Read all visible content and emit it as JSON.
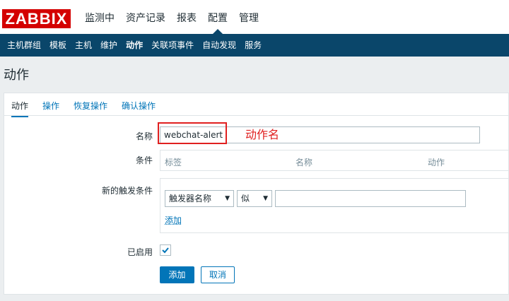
{
  "header": {
    "logo": "ZABBIX",
    "menu": [
      {
        "label": "监测中"
      },
      {
        "label": "资产记录"
      },
      {
        "label": "报表"
      },
      {
        "label": "配置"
      },
      {
        "label": "管理"
      }
    ]
  },
  "submenu": [
    {
      "label": "主机群组"
    },
    {
      "label": "模板"
    },
    {
      "label": "主机"
    },
    {
      "label": "维护"
    },
    {
      "label": "动作"
    },
    {
      "label": "关联项事件"
    },
    {
      "label": "自动发现"
    },
    {
      "label": "服务"
    }
  ],
  "page_title": "动作",
  "tabs": [
    {
      "label": "动作"
    },
    {
      "label": "操作"
    },
    {
      "label": "恢复操作"
    },
    {
      "label": "确认操作"
    }
  ],
  "form": {
    "name_label": "名称",
    "name_value": "webchat-alert",
    "annotation": "动作名",
    "conditions_label": "条件",
    "conditions_columns": [
      "标签",
      "名称",
      "动作"
    ],
    "new_condition_label": "新的触发条件",
    "condition_type": "触发器名称",
    "condition_operator": "似",
    "condition_value": "",
    "add_link": "添加",
    "enabled_label": "已启用",
    "enabled": true,
    "add_button": "添加",
    "cancel_button": "取消"
  },
  "colors": {
    "brand": "#d40000",
    "nav": "#0a466a",
    "accent": "#0275b8",
    "annotation": "#e02020"
  },
  "icons": {
    "dropdown": "chevron-down-icon",
    "check": "check-icon"
  }
}
